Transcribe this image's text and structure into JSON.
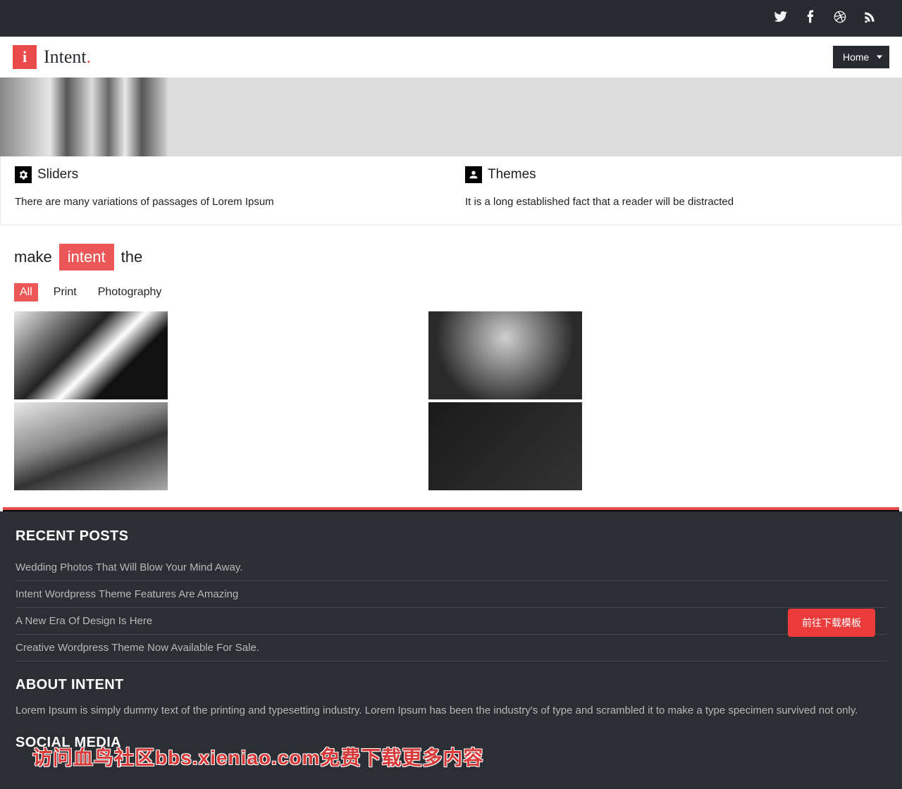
{
  "nav": {
    "selected": "Home"
  },
  "logo": {
    "badge": "i",
    "text": "Intent"
  },
  "panels": {
    "left": {
      "title": "Sliders",
      "text": "There are many variations of passages of Lorem Ipsum"
    },
    "right": {
      "title": "Themes",
      "text": "It is a long established fact that a reader will be distracted"
    }
  },
  "intent": {
    "before": "make",
    "highlight": "intent",
    "after": "the"
  },
  "filters": [
    "All",
    "Print",
    "Photography"
  ],
  "active_filter": "All",
  "footer": {
    "recent_title": "RECENT POSTS",
    "posts": [
      "Wedding Photos That Will Blow Your Mind Away.",
      "Intent Wordpress Theme Features Are Amazing",
      "A New Era Of Design Is Here",
      "Creative Wordpress Theme Now Available For Sale."
    ],
    "about_title": "ABOUT INTENT",
    "about_text": "Lorem Ipsum is simply dummy text of the printing and typesetting industry. Lorem Ipsum has been the industry's of type and scrambled it to make a type specimen survived not only.",
    "social_title": "SOCIAL MEDIA"
  },
  "download_button": "前往下载模板",
  "overlay_text": "访问血鸟社区bbs.xieniao.com免费下载更多内容"
}
